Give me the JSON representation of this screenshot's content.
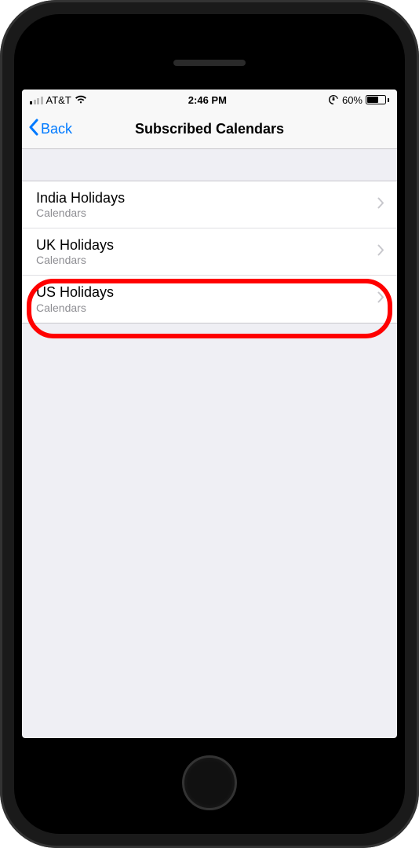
{
  "status": {
    "carrier": "AT&T",
    "time": "2:46 PM",
    "battery_pct": "60%"
  },
  "nav": {
    "back_label": "Back",
    "title": "Subscribed Calendars"
  },
  "calendars": {
    "subtitle": "Calendars",
    "items": [
      {
        "title": "India Holidays"
      },
      {
        "title": "UK Holidays"
      },
      {
        "title": "US Holidays"
      }
    ]
  }
}
